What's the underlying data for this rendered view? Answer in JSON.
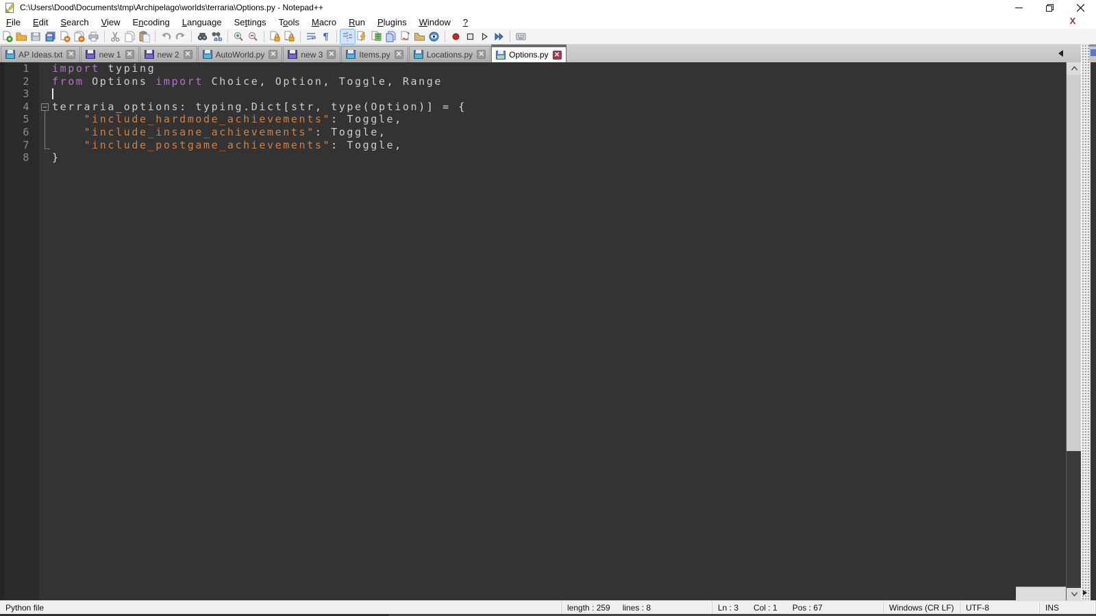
{
  "window": {
    "title": "C:\\Users\\Dood\\Documents\\tmp\\Archipelago\\worlds\\terraria\\Options.py - Notepad++",
    "controls": [
      "minimize-button",
      "restore-button",
      "close-button"
    ]
  },
  "menu": {
    "items": [
      {
        "label": "File",
        "mnemonic": 0
      },
      {
        "label": "Edit",
        "mnemonic": 0
      },
      {
        "label": "Search",
        "mnemonic": 0
      },
      {
        "label": "View",
        "mnemonic": 0
      },
      {
        "label": "Encoding",
        "mnemonic": 1
      },
      {
        "label": "Language",
        "mnemonic": 0
      },
      {
        "label": "Settings",
        "mnemonic": 2
      },
      {
        "label": "Tools",
        "mnemonic": 1
      },
      {
        "label": "Macro",
        "mnemonic": 0
      },
      {
        "label": "Run",
        "mnemonic": 0
      },
      {
        "label": "Plugins",
        "mnemonic": 0
      },
      {
        "label": "Window",
        "mnemonic": 0
      },
      {
        "label": "?",
        "mnemonic": 0
      }
    ],
    "close_doc_label": "X"
  },
  "toolbar": {
    "groups": [
      [
        "new-file",
        "open-file",
        "save",
        "save-all",
        "close",
        "close-all",
        "print"
      ],
      [
        "cut",
        "copy",
        "paste"
      ],
      [
        "undo",
        "redo"
      ],
      [
        "find",
        "replace"
      ],
      [
        "zoom-in",
        "zoom-out"
      ],
      [
        "sync-vertical-scroll",
        "sync-horizontal-scroll"
      ],
      [
        "word-wrap",
        "show-all-characters"
      ],
      [
        "indent-guide",
        "function-list",
        "document-map",
        "document-list",
        "define-language",
        "folder-as-workspace",
        "monitoring"
      ],
      [
        "macro-record",
        "macro-stop",
        "macro-play",
        "macro-run-multiple"
      ],
      [
        "macro-save"
      ]
    ],
    "pressed": "indent-guide"
  },
  "tabs": [
    {
      "label": "AP Ideas.txt",
      "icon": "saved",
      "active": false
    },
    {
      "label": "new 1",
      "icon": "new",
      "active": false
    },
    {
      "label": "new 2",
      "icon": "new",
      "active": false
    },
    {
      "label": "AutoWorld.py",
      "icon": "saved",
      "active": false
    },
    {
      "label": "new 3",
      "icon": "new",
      "active": false
    },
    {
      "label": "Items.py",
      "icon": "saved",
      "active": false
    },
    {
      "label": "Locations.py",
      "icon": "saved",
      "active": false
    },
    {
      "label": "Options.py",
      "icon": "saved-active",
      "active": true
    }
  ],
  "editor": {
    "cursor_line": 3,
    "folds": {
      "4": "box",
      "5": "line",
      "6": "line",
      "7": "corner"
    },
    "lines": [
      {
        "num": "1",
        "segments": [
          {
            "t": "import",
            "c": "kw"
          },
          {
            "t": " typing",
            "c": "def"
          }
        ]
      },
      {
        "num": "2",
        "segments": [
          {
            "t": "from",
            "c": "kw"
          },
          {
            "t": " Options ",
            "c": "def"
          },
          {
            "t": "import",
            "c": "kw"
          },
          {
            "t": " Choice",
            "c": "def"
          },
          {
            "t": ",",
            "c": "op"
          },
          {
            "t": " Option",
            "c": "def"
          },
          {
            "t": ",",
            "c": "op"
          },
          {
            "t": " Toggle",
            "c": "def"
          },
          {
            "t": ",",
            "c": "op"
          },
          {
            "t": " Range",
            "c": "def"
          }
        ]
      },
      {
        "num": "3",
        "segments": []
      },
      {
        "num": "4",
        "segments": [
          {
            "t": "terraria_options",
            "c": "def"
          },
          {
            "t": ":",
            "c": "op"
          },
          {
            "t": " typing",
            "c": "def"
          },
          {
            "t": ".",
            "c": "op"
          },
          {
            "t": "Dict",
            "c": "def"
          },
          {
            "t": "[",
            "c": "op"
          },
          {
            "t": "str",
            "c": "def"
          },
          {
            "t": ",",
            "c": "op"
          },
          {
            "t": " type",
            "c": "def"
          },
          {
            "t": "(",
            "c": "op"
          },
          {
            "t": "Option",
            "c": "def"
          },
          {
            "t": ")]",
            "c": "op"
          },
          {
            "t": " ",
            "c": "def"
          },
          {
            "t": "=",
            "c": "op"
          },
          {
            "t": " ",
            "c": "def"
          },
          {
            "t": "{",
            "c": "op"
          }
        ]
      },
      {
        "num": "5",
        "segments": [
          {
            "t": "    ",
            "c": "def"
          },
          {
            "t": "\"include_hardmode_achievements\"",
            "c": "str"
          },
          {
            "t": ":",
            "c": "op"
          },
          {
            "t": " Toggle",
            "c": "def"
          },
          {
            "t": ",",
            "c": "op"
          }
        ]
      },
      {
        "num": "6",
        "segments": [
          {
            "t": "    ",
            "c": "def"
          },
          {
            "t": "\"include_insane_achievements\"",
            "c": "str"
          },
          {
            "t": ":",
            "c": "op"
          },
          {
            "t": " Toggle",
            "c": "def"
          },
          {
            "t": ",",
            "c": "op"
          }
        ]
      },
      {
        "num": "7",
        "segments": [
          {
            "t": "    ",
            "c": "def"
          },
          {
            "t": "\"include_postgame_achievements\"",
            "c": "str"
          },
          {
            "t": ":",
            "c": "op"
          },
          {
            "t": " Toggle",
            "c": "def"
          },
          {
            "t": ",",
            "c": "op"
          }
        ]
      },
      {
        "num": "8",
        "segments": [
          {
            "t": "}",
            "c": "op"
          }
        ]
      }
    ]
  },
  "status": {
    "doc_type": "Python file",
    "length": "length : 259",
    "lines": "lines : 8",
    "ln": "Ln : 3",
    "col": "Col : 1",
    "pos": "Pos : 67",
    "eol": "Windows (CR LF)",
    "encoding": "UTF-8",
    "mode": "INS"
  },
  "colors": {
    "keyword": "#b277c4",
    "string": "#d6803f",
    "default_text": "#cfcfcf",
    "operator": "#dcdcdc",
    "editor_bg": "#333333",
    "gutter_bg": "#2a2a2a",
    "line_number": "#8d8d8d",
    "active_tab_close": "#a03e4c"
  }
}
